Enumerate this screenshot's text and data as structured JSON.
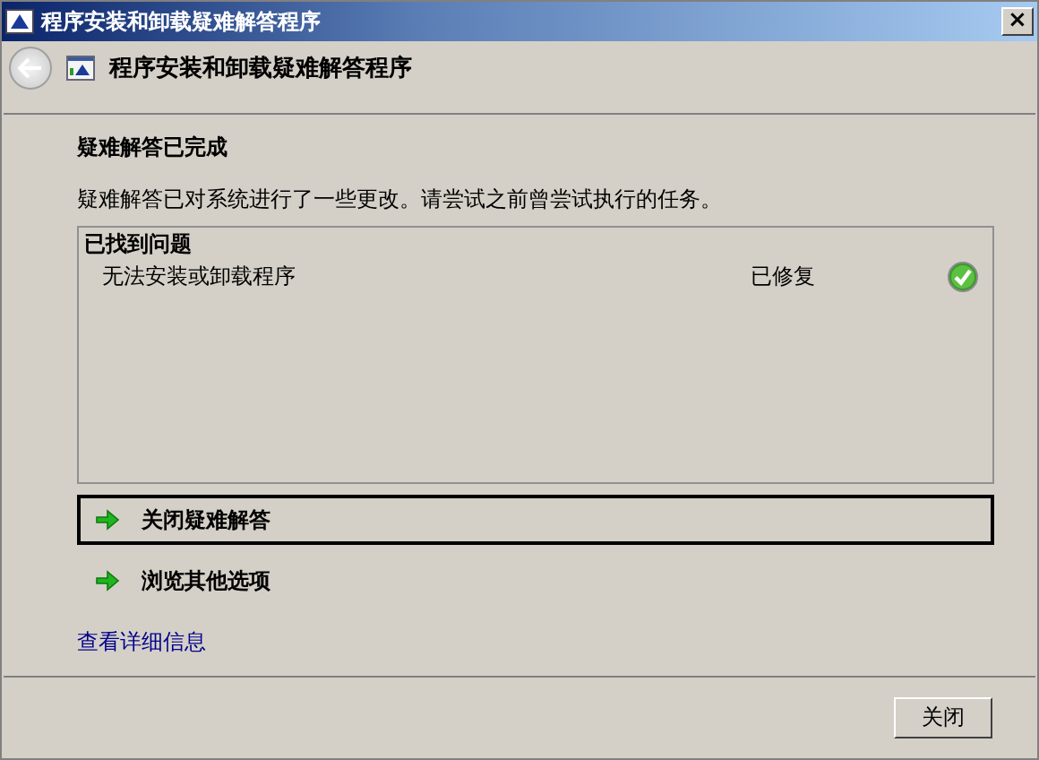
{
  "window": {
    "title": "程序安装和卸载疑难解答程序",
    "close": "×"
  },
  "header": {
    "title": "程序安装和卸载疑难解答程序"
  },
  "heading": "疑难解答已完成",
  "message": "疑难解答已对系统进行了一些更改。请尝试之前曾尝试执行的任务。",
  "problems": {
    "title": "已找到问题",
    "rows": [
      {
        "name": "无法安装或卸载程序",
        "status": "已修复",
        "fixed": true
      }
    ]
  },
  "options": [
    {
      "label": "关闭疑难解答",
      "focused": true
    },
    {
      "label": "浏览其他选项",
      "focused": false
    }
  ],
  "details_link": "查看详细信息",
  "buttons": [
    "关闭"
  ]
}
